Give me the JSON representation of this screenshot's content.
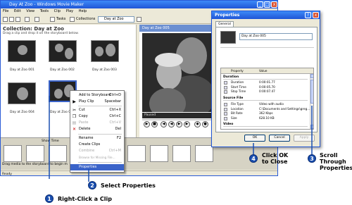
{
  "window": {
    "title": "Day At Zoo - Windows Movie Maker",
    "minimize": "_",
    "maximize": "□",
    "close": "x"
  },
  "menu": [
    "File",
    "Edit",
    "View",
    "Tools",
    "Clip",
    "Play",
    "Help"
  ],
  "toolbar": {
    "tasks_label": "Tasks",
    "collections_label": "Collections",
    "collection_select": "Day at Zoo"
  },
  "collection": {
    "title": "Collection: Day at Zoo",
    "subtitle": "Drag a clip and drop it on the storyboard below.",
    "clips": [
      "Day at Zoo 001",
      "Day at Zoo 002",
      "Day at Zoo 003",
      "Day at Zoo 004",
      "Day at Zoo 005"
    ]
  },
  "preview": {
    "title": "Day at Zoo 005",
    "status": "Paused",
    "controls": [
      "play-icon",
      "stop-icon",
      "previous-icon",
      "rewind-icon",
      "forward-icon",
      "next-icon"
    ]
  },
  "storyboard": {
    "show_timeline": "Show Time",
    "hint": "Drag media to the storyboard to begin m"
  },
  "statusbar": "Ready",
  "context_menu": {
    "items": [
      {
        "label": "Add to Storyboard",
        "shortcut": "Ctrl+D",
        "disabled": false,
        "icon": ""
      },
      {
        "label": "Play Clip",
        "shortcut": "Spacebar",
        "disabled": false,
        "icon": "play-icon"
      },
      {
        "label": "Cut",
        "shortcut": "Ctrl+X",
        "disabled": false,
        "icon": "scissors-icon"
      },
      {
        "label": "Copy",
        "shortcut": "Ctrl+C",
        "disabled": false,
        "icon": "copy-icon"
      },
      {
        "label": "Paste",
        "shortcut": "Ctrl+V",
        "disabled": true,
        "icon": "paste-icon"
      },
      {
        "label": "Delete",
        "shortcut": "Del",
        "disabled": false,
        "icon": "delete-icon"
      },
      {
        "label": "Rename",
        "shortcut": "F2",
        "disabled": false,
        "icon": ""
      },
      {
        "label": "Create Clips",
        "shortcut": "",
        "disabled": false,
        "icon": ""
      },
      {
        "label": "Combine",
        "shortcut": "Ctrl+M",
        "disabled": true,
        "icon": ""
      },
      {
        "label": "Browse for Missing File...",
        "shortcut": "",
        "disabled": true,
        "icon": ""
      },
      {
        "label": "Properties",
        "shortcut": "",
        "disabled": false,
        "icon": ""
      }
    ]
  },
  "properties_dialog": {
    "title": "Properties",
    "help": "?",
    "close": "x",
    "tab": "General",
    "name_value": "Day at Zoo 005",
    "columns": [
      "Property",
      "Value"
    ],
    "groups": [
      {
        "label": "Duration",
        "rows": [
          {
            "property": "Duration",
            "value": "0:00:01.77"
          },
          {
            "property": "Start Time",
            "value": "0:00:05.70"
          },
          {
            "property": "Stop Time",
            "value": "0:00:07.47"
          }
        ]
      },
      {
        "label": "Source File",
        "rows": [
          {
            "property": "File Type",
            "value": "Video with audio"
          },
          {
            "property": "Location",
            "value": "C:\\Documents and Settings\\greg..."
          },
          {
            "property": "Bit Rate",
            "value": "362 Kbps"
          },
          {
            "property": "Size",
            "value": "628.10 KB"
          }
        ]
      },
      {
        "label": "Video",
        "rows": []
      }
    ],
    "ok": "OK",
    "cancel": "Cancel",
    "apply": "Apply"
  },
  "callouts": [
    {
      "number": "1",
      "text": "Right-Click a Clip"
    },
    {
      "number": "2",
      "text": "Select Properties"
    },
    {
      "number": "3",
      "text": "Scroll Through Properties"
    },
    {
      "number": "4",
      "text": "Click OK to Close"
    }
  ],
  "colors": {
    "callout_badge": "#1a4fb0",
    "title_bar": "#1f55d6",
    "menu_highlight": "#3a63c9"
  }
}
